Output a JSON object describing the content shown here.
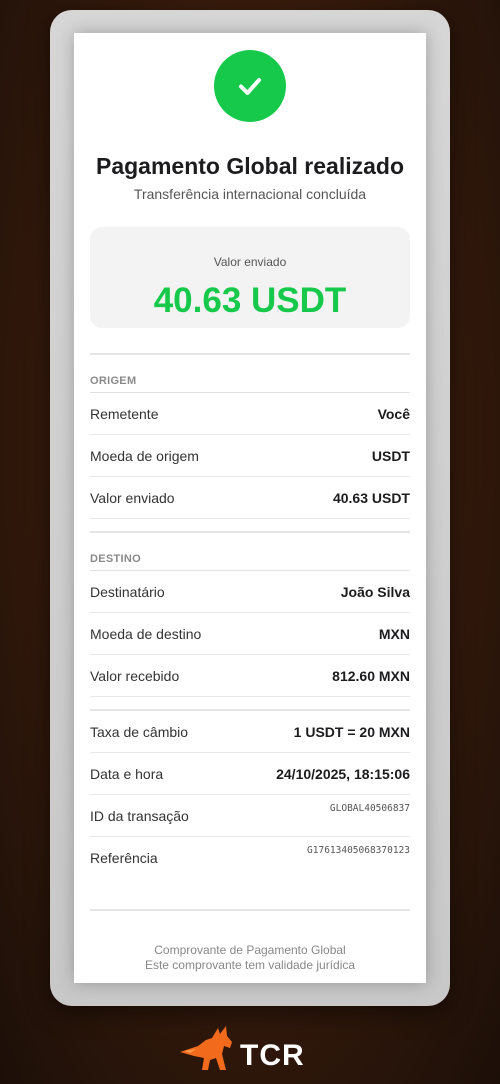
{
  "header": {
    "title": "Pagamento Global realizado",
    "subtitle": "Transferência internacional concluída"
  },
  "amount": {
    "label": "Valor enviado",
    "value": "40.63 USDT"
  },
  "origin": {
    "section_label": "ORIGEM",
    "rows": [
      {
        "key": "Remetente",
        "value": "Você"
      },
      {
        "key": "Moeda de origem",
        "value": "USDT"
      },
      {
        "key": "Valor enviado",
        "value": "40.63 USDT"
      }
    ]
  },
  "destination": {
    "section_label": "DESTINO",
    "rows": [
      {
        "key": "Destinatário",
        "value": "João Silva"
      },
      {
        "key": "Moeda de destino",
        "value": "MXN"
      },
      {
        "key": "Valor recebido",
        "value": "812.60 MXN"
      }
    ]
  },
  "details": {
    "rows": [
      {
        "key": "Taxa de câmbio",
        "value": "1 USDT = 20 MXN"
      },
      {
        "key": "Data e hora",
        "value": "24/10/2025, 18:15:06"
      },
      {
        "key": "ID da transação",
        "value": "GLOBAL40506837"
      },
      {
        "key": "Referência",
        "value": "G17613405068370123"
      }
    ]
  },
  "footer": {
    "line1": "Comprovante de Pagamento Global",
    "line2": "Este comprovante tem validade jurídica"
  },
  "brand": {
    "name": "TCR",
    "logo_icon": "wolf-icon",
    "logo_color": "#f26a1b"
  },
  "colors": {
    "success": "#16c94a",
    "background": "#3a1c0c"
  }
}
